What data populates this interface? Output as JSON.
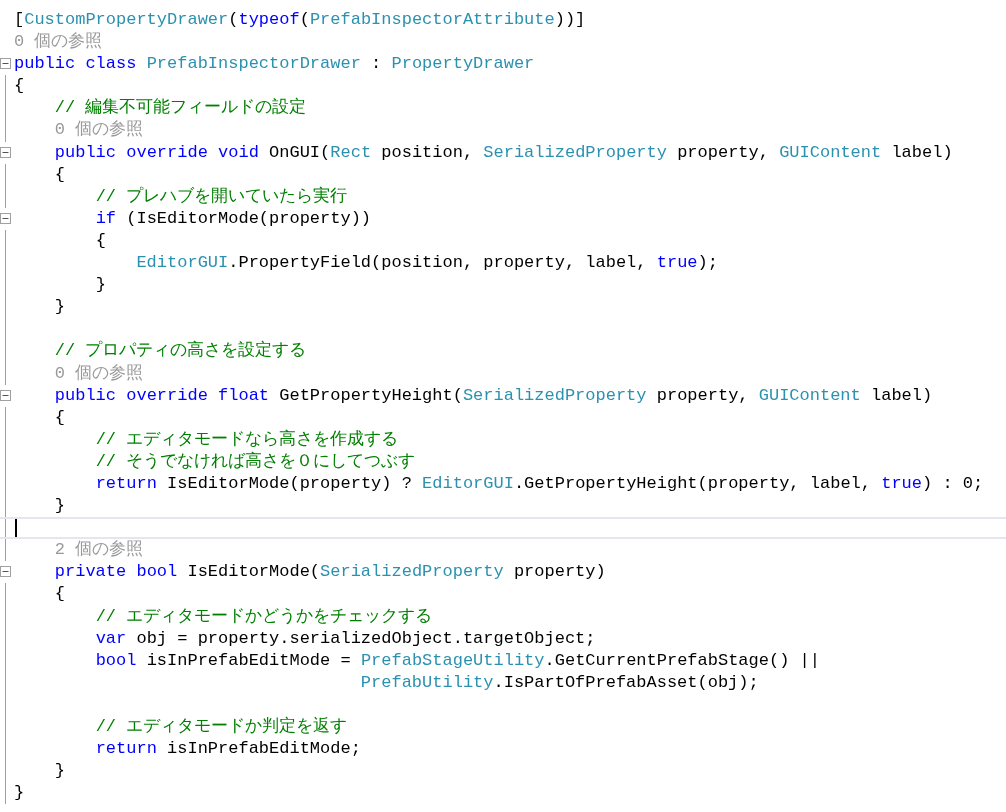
{
  "editor": {
    "lines": [
      {
        "current": false,
        "tokens": [
          {
            "kind": "plain",
            "text": "["
          },
          {
            "kind": "type",
            "text": "CustomPropertyDrawer"
          },
          {
            "kind": "plain",
            "text": "("
          },
          {
            "kind": "keyword",
            "text": "typeof"
          },
          {
            "kind": "plain",
            "text": "("
          },
          {
            "kind": "type",
            "text": "PrefabInspectorAttribute"
          },
          {
            "kind": "plain",
            "text": "))]"
          }
        ]
      },
      {
        "current": false,
        "tokens": [
          {
            "kind": "lens",
            "text": "0 個の参照"
          }
        ]
      },
      {
        "current": false,
        "collapsed": false,
        "tokens": [
          {
            "kind": "keyword",
            "text": "public class "
          },
          {
            "kind": "type",
            "text": "PrefabInspectorDrawer"
          },
          {
            "kind": "plain",
            "text": " : "
          },
          {
            "kind": "type",
            "text": "PropertyDrawer"
          }
        ]
      },
      {
        "current": false,
        "tokens": [
          {
            "kind": "plain",
            "text": "{"
          }
        ]
      },
      {
        "current": false,
        "tokens": [
          {
            "kind": "comment",
            "text": "    // 編集不可能フィールドの設定"
          }
        ]
      },
      {
        "current": false,
        "tokens": [
          {
            "kind": "lens",
            "text": "    0 個の参照"
          }
        ]
      },
      {
        "current": false,
        "collapsed": false,
        "tokens": [
          {
            "kind": "keyword",
            "text": "    public override void "
          },
          {
            "kind": "plain",
            "text": "OnGUI("
          },
          {
            "kind": "type",
            "text": "Rect"
          },
          {
            "kind": "plain",
            "text": " position, "
          },
          {
            "kind": "type",
            "text": "SerializedProperty"
          },
          {
            "kind": "plain",
            "text": " property, "
          },
          {
            "kind": "type",
            "text": "GUIContent"
          },
          {
            "kind": "plain",
            "text": " label)"
          }
        ]
      },
      {
        "current": false,
        "tokens": [
          {
            "kind": "plain",
            "text": "    {"
          }
        ]
      },
      {
        "current": false,
        "tokens": [
          {
            "kind": "comment",
            "text": "        // プレハブを開いていたら実行"
          }
        ]
      },
      {
        "current": false,
        "collapsed": false,
        "tokens": [
          {
            "kind": "keyword",
            "text": "        if"
          },
          {
            "kind": "plain",
            "text": " (IsEditorMode(property))"
          }
        ]
      },
      {
        "current": false,
        "tokens": [
          {
            "kind": "plain",
            "text": "        {"
          }
        ]
      },
      {
        "current": false,
        "tokens": [
          {
            "kind": "type",
            "text": "            EditorGUI"
          },
          {
            "kind": "plain",
            "text": ".PropertyField(position, property, label, "
          },
          {
            "kind": "keyword",
            "text": "true"
          },
          {
            "kind": "plain",
            "text": ");"
          }
        ]
      },
      {
        "current": false,
        "tokens": [
          {
            "kind": "plain",
            "text": "        }"
          }
        ]
      },
      {
        "current": false,
        "tokens": [
          {
            "kind": "plain",
            "text": "    }"
          }
        ]
      },
      {
        "current": false
      },
      {
        "current": false,
        "tokens": [
          {
            "kind": "comment",
            "text": "    // プロパティの高さを設定する"
          }
        ]
      },
      {
        "current": false,
        "tokens": [
          {
            "kind": "lens",
            "text": "    0 個の参照"
          }
        ]
      },
      {
        "current": false,
        "collapsed": false,
        "tokens": [
          {
            "kind": "keyword",
            "text": "    public override float "
          },
          {
            "kind": "plain",
            "text": "GetPropertyHeight("
          },
          {
            "kind": "type",
            "text": "SerializedProperty"
          },
          {
            "kind": "plain",
            "text": " property, "
          },
          {
            "kind": "type",
            "text": "GUIContent"
          },
          {
            "kind": "plain",
            "text": " label)"
          }
        ]
      },
      {
        "current": false,
        "tokens": [
          {
            "kind": "plain",
            "text": "    {"
          }
        ]
      },
      {
        "current": false,
        "tokens": [
          {
            "kind": "comment",
            "text": "        // エディタモードなら高さを作成する"
          }
        ]
      },
      {
        "current": false,
        "tokens": [
          {
            "kind": "comment",
            "text": "        // そうでなければ高さを０にしてつぶす"
          }
        ]
      },
      {
        "current": false,
        "tokens": [
          {
            "kind": "keyword",
            "text": "        return "
          },
          {
            "kind": "plain",
            "text": "IsEditorMode(property) ? "
          },
          {
            "kind": "type",
            "text": "EditorGUI"
          },
          {
            "kind": "plain",
            "text": ".GetPropertyHeight(property, label, "
          },
          {
            "kind": "keyword",
            "text": "true"
          },
          {
            "kind": "plain",
            "text": ") : 0;"
          }
        ]
      },
      {
        "current": false,
        "tokens": [
          {
            "kind": "plain",
            "text": "    }"
          }
        ]
      },
      {
        "current": true
      },
      {
        "current": false,
        "tokens": [
          {
            "kind": "lens",
            "text": "    2 個の参照"
          }
        ]
      },
      {
        "current": false,
        "collapsed": false,
        "tokens": [
          {
            "kind": "keyword",
            "text": "    private bool "
          },
          {
            "kind": "plain",
            "text": "IsEditorMode("
          },
          {
            "kind": "type",
            "text": "SerializedProperty"
          },
          {
            "kind": "plain",
            "text": " property)"
          }
        ]
      },
      {
        "current": false,
        "tokens": [
          {
            "kind": "plain",
            "text": "    {"
          }
        ]
      },
      {
        "current": false,
        "tokens": [
          {
            "kind": "comment",
            "text": "        // エディタモードかどうかをチェックする"
          }
        ]
      },
      {
        "current": false,
        "tokens": [
          {
            "kind": "keyword",
            "text": "        var "
          },
          {
            "kind": "plain",
            "text": "obj = property.serializedObject.targetObject;"
          }
        ]
      },
      {
        "current": false,
        "tokens": [
          {
            "kind": "keyword",
            "text": "        bool "
          },
          {
            "kind": "plain",
            "text": "isInPrefabEditMode = "
          },
          {
            "kind": "type",
            "text": "PrefabStageUtility"
          },
          {
            "kind": "plain",
            "text": ".GetCurrentPrefabStage() ||"
          }
        ]
      },
      {
        "current": false,
        "tokens": [
          {
            "kind": "type",
            "text": "                                  PrefabUtility"
          },
          {
            "kind": "plain",
            "text": ".IsPartOfPrefabAsset(obj);"
          }
        ]
      },
      {
        "current": false
      },
      {
        "current": false,
        "tokens": [
          {
            "kind": "comment",
            "text": "        // エディタモードか判定を返す"
          }
        ]
      },
      {
        "current": false,
        "tokens": [
          {
            "kind": "keyword",
            "text": "        return "
          },
          {
            "kind": "plain",
            "text": "isInPrefabEditMode;"
          }
        ]
      },
      {
        "current": false,
        "tokens": [
          {
            "kind": "plain",
            "text": "    }"
          }
        ]
      },
      {
        "current": false,
        "tokens": [
          {
            "kind": "plain",
            "text": "}"
          }
        ]
      }
    ]
  }
}
